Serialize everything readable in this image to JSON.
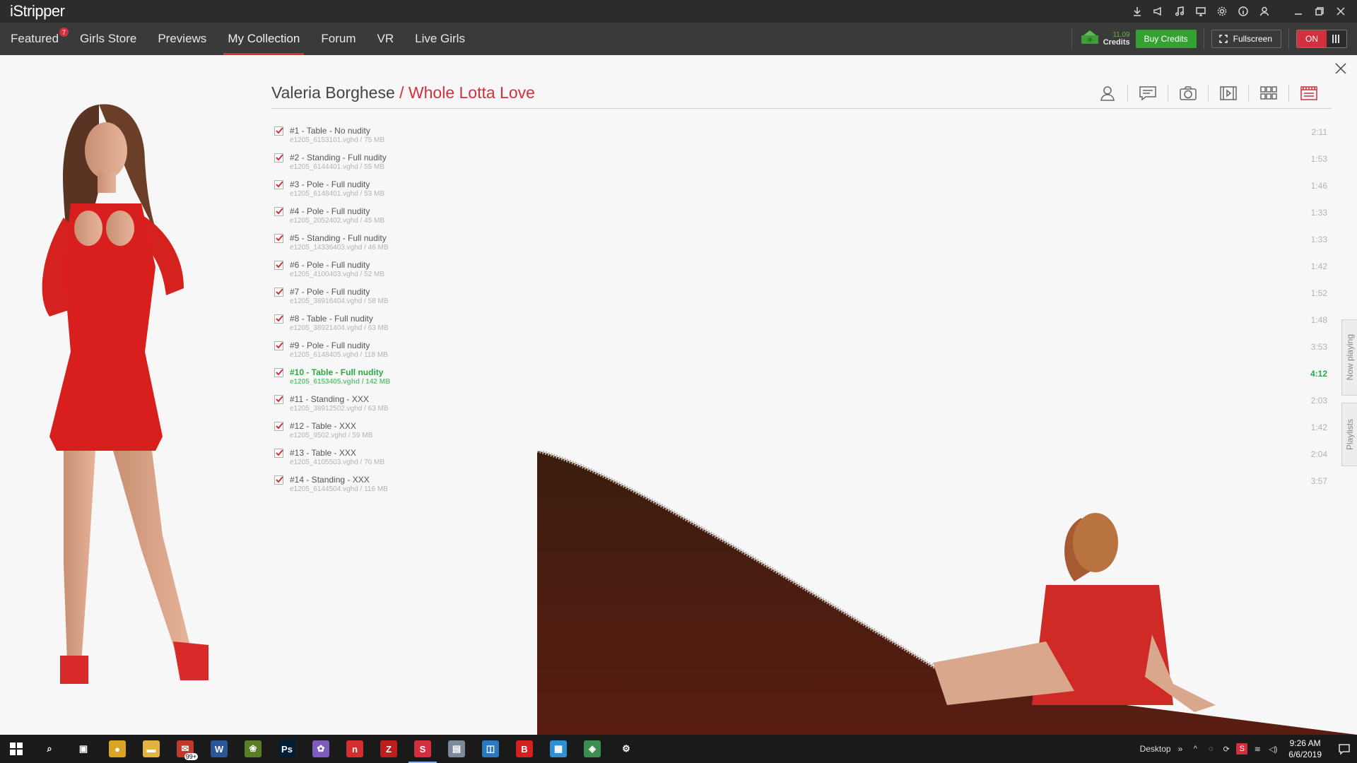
{
  "app": {
    "logo": "iStripper"
  },
  "titlebar_icons": [
    {
      "name": "download-icon"
    },
    {
      "name": "megaphone-icon"
    },
    {
      "name": "music-icon"
    },
    {
      "name": "monitor-icon"
    },
    {
      "name": "gear-icon"
    },
    {
      "name": "info-icon"
    },
    {
      "name": "user-icon"
    },
    {
      "name": "minimize-icon"
    },
    {
      "name": "restore-icon"
    },
    {
      "name": "close-icon"
    }
  ],
  "nav": {
    "items": [
      {
        "label": "Featured",
        "badge": "7"
      },
      {
        "label": "Girls Store"
      },
      {
        "label": "Previews"
      },
      {
        "label": "My Collection",
        "active": true
      },
      {
        "label": "Forum"
      },
      {
        "label": "VR"
      },
      {
        "label": "Live Girls"
      }
    ],
    "credits_amount": "11.09",
    "credits_label": "Credits",
    "buy_credits": "Buy Credits",
    "fullscreen": "Fullscreen",
    "toggle_on": "ON"
  },
  "header": {
    "model": "Valeria Borghese",
    "separator": " / ",
    "show": "Whole Lotta Love"
  },
  "clips": [
    {
      "title": "#1 - Table - No nudity",
      "file": "e1205_6153101.vghd / 75 MB",
      "duration": "2:11"
    },
    {
      "title": "#2 - Standing - Full nudity",
      "file": "e1205_6144401.vghd / 55 MB",
      "duration": "1:53"
    },
    {
      "title": "#3 - Pole - Full nudity",
      "file": "e1205_6148401.vghd / 53 MB",
      "duration": "1:46"
    },
    {
      "title": "#4 - Pole - Full nudity",
      "file": "e1205_2052402.vghd / 45 MB",
      "duration": "1:33"
    },
    {
      "title": "#5 - Standing - Full nudity",
      "file": "e1205_14336403.vghd / 46 MB",
      "duration": "1:33"
    },
    {
      "title": "#6 - Pole - Full nudity",
      "file": "e1205_4100403.vghd / 52 MB",
      "duration": "1:42"
    },
    {
      "title": "#7 - Pole - Full nudity",
      "file": "e1205_38916404.vghd / 58 MB",
      "duration": "1:52"
    },
    {
      "title": "#8 - Table - Full nudity",
      "file": "e1205_38921404.vghd / 63 MB",
      "duration": "1:48"
    },
    {
      "title": "#9 - Pole - Full nudity",
      "file": "e1205_6148405.vghd / 118 MB",
      "duration": "3:53"
    },
    {
      "title": "#10 - Table - Full nudity",
      "file": "e1205_6153405.vghd / 142 MB",
      "duration": "4:12",
      "playing": true
    },
    {
      "title": "#11 - Standing - XXX",
      "file": "e1205_38912502.vghd / 63 MB",
      "duration": "2:03"
    },
    {
      "title": "#12 - Table - XXX",
      "file": "e1205_9502.vghd / 59 MB",
      "duration": "1:42"
    },
    {
      "title": "#13 - Table - XXX",
      "file": "e1205_4105503.vghd / 70 MB",
      "duration": "2:04"
    },
    {
      "title": "#14 - Standing - XXX",
      "file": "e1205_6144504.vghd / 116 MB",
      "duration": "3:57"
    }
  ],
  "side_tabs": {
    "now_playing": "Now playing",
    "playlists": "Playlists"
  },
  "taskbar": {
    "apps": [
      {
        "name": "search-icon",
        "glyph": "⌕",
        "color": "#1a1a1a"
      },
      {
        "name": "task-view-icon",
        "glyph": "▣",
        "color": "#1a1a1a"
      },
      {
        "name": "chrome-icon",
        "glyph": "●",
        "color": "#d9a526"
      },
      {
        "name": "file-explorer-icon",
        "glyph": "▬",
        "color": "#e3b341"
      },
      {
        "name": "mail-app-icon",
        "glyph": "✉",
        "color": "#c0392b",
        "badge": "99+"
      },
      {
        "name": "word-icon",
        "glyph": "W",
        "color": "#2b579a"
      },
      {
        "name": "game-icon",
        "glyph": "❀",
        "color": "#5a7d2a"
      },
      {
        "name": "photoshop-icon",
        "glyph": "Ps",
        "color": "#001e36"
      },
      {
        "name": "paint-icon",
        "glyph": "✿",
        "color": "#7c5cbf"
      },
      {
        "name": "nero-icon",
        "glyph": "n",
        "color": "#d42f2f"
      },
      {
        "name": "filezilla-icon",
        "glyph": "Z",
        "color": "#bf1e1e"
      },
      {
        "name": "istripper-icon",
        "glyph": "S",
        "color": "#d42f3e",
        "active": true
      },
      {
        "name": "scanner-icon",
        "glyph": "▤",
        "color": "#7a8a99"
      },
      {
        "name": "outlook-icon",
        "glyph": "◫",
        "color": "#2a7ac2"
      },
      {
        "name": "bitdefender-icon",
        "glyph": "B",
        "color": "#d42020"
      },
      {
        "name": "store-icon",
        "glyph": "▦",
        "color": "#2f8fd4"
      },
      {
        "name": "network-app-icon",
        "glyph": "◈",
        "color": "#3b8e4f"
      },
      {
        "name": "settings-icon",
        "glyph": "⚙",
        "color": "#1a1a1a"
      }
    ],
    "desktop_label": "Desktop",
    "overflow": "»",
    "time": "9:26 AM",
    "date": "6/6/2019"
  }
}
